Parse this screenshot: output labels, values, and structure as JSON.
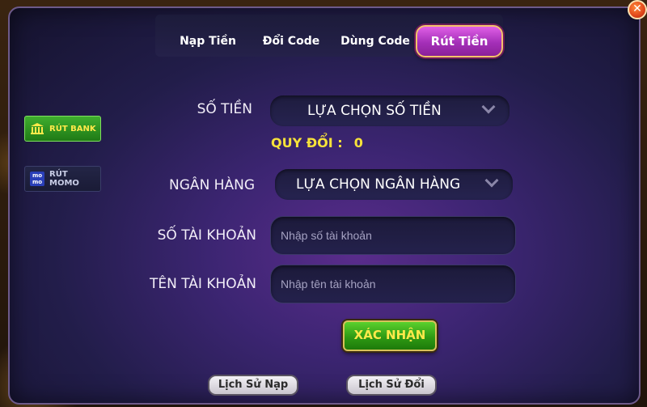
{
  "tabs": [
    {
      "label": "Nạp Tiền"
    },
    {
      "label": "Đổi Code"
    },
    {
      "label": "Dùng Code"
    },
    {
      "label": "Rút Tiền",
      "active": true
    }
  ],
  "close_label": "✕",
  "sidebar": {
    "items": [
      {
        "label": "RÚT BANK",
        "icon": "bank-icon",
        "active": true
      },
      {
        "label": "RÚT MOMO",
        "icon": "momo-icon",
        "icon_text": "mo mo"
      }
    ]
  },
  "form": {
    "amount_label": "SỐ TIỀN",
    "amount_select": "LỰA CHỌN SỐ TIỀN",
    "convert_label": "QUY ĐỔI :",
    "convert_value": "0",
    "bank_label": "NGÂN HÀNG",
    "bank_select": "LỰA CHỌN NGÂN HÀNG",
    "account_number_label": "SỐ TÀI KHOẢN",
    "account_number_placeholder": "Nhập số tài khoản",
    "account_name_label": "TÊN TÀI KHOẢN",
    "account_name_placeholder": "Nhập tên tài khoản",
    "confirm_label": "XÁC NHẬN"
  },
  "history": {
    "deposit_label": "Lịch Sử Nạp",
    "exchange_label": "Lịch Sử Đổi"
  },
  "colors": {
    "accent_tab": "#c23fd0",
    "highlight_text": "#f7e23a",
    "confirm_green": "#2f9a14"
  }
}
